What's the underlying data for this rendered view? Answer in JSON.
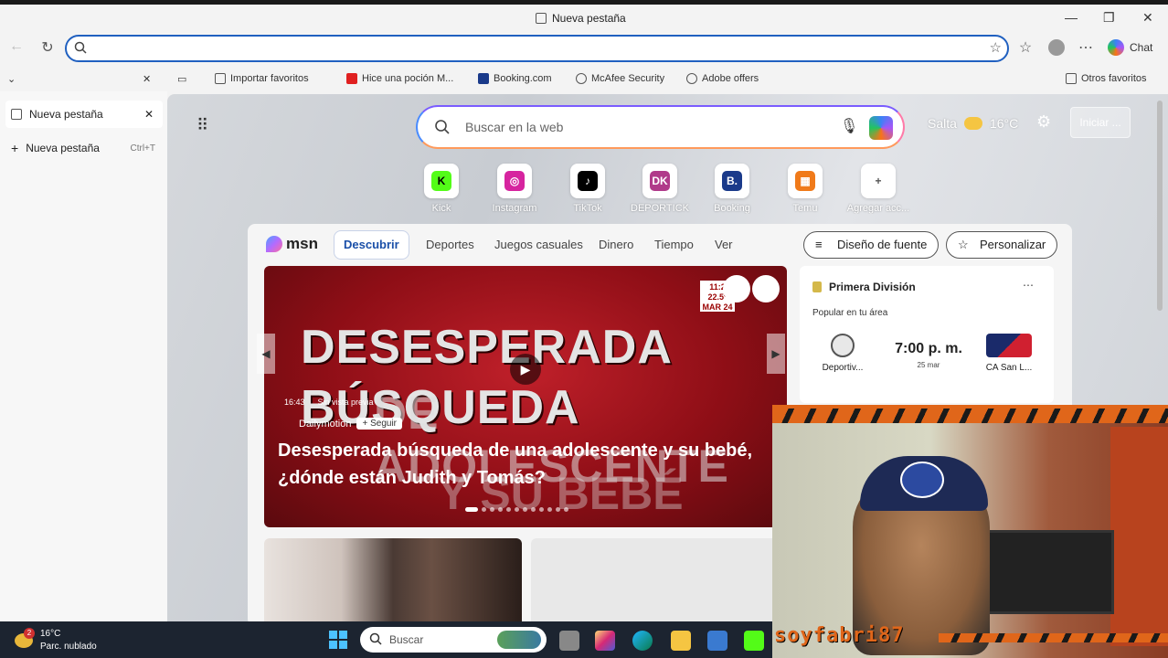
{
  "window": {
    "title": "Nueva pestaña"
  },
  "colors": {
    "accent": "#2060c0",
    "cam_accent": "#e0661a",
    "taskbar": "#1c2430"
  },
  "toolbar": {
    "chat_label": "Chat"
  },
  "favorites": [
    {
      "label": "Importar favoritos",
      "icon": "import-icon",
      "color": "#555555"
    },
    {
      "label": "Hice una poción M...",
      "icon": "youtube-icon",
      "color": "#e02020"
    },
    {
      "label": "Booking.com",
      "icon": "booking-icon",
      "color": "#1a3a8a"
    },
    {
      "label": "McAfee Security",
      "icon": "globe-icon",
      "color": "#555555"
    },
    {
      "label": "Adobe offers",
      "icon": "globe-icon",
      "color": "#555555"
    }
  ],
  "favorites_other": "Otros favoritos",
  "side_tabs": [
    {
      "label": "Nueva pestaña",
      "shortcut": ""
    },
    {
      "label": "Nueva pestaña",
      "shortcut": "Ctrl+T"
    }
  ],
  "search": {
    "placeholder": "Buscar en la web"
  },
  "weather": {
    "city": "Salta",
    "temp": "16°C"
  },
  "iniciar_label": "Iniciar ...",
  "quick_links": [
    {
      "label": "Kick",
      "glyph": "K",
      "color": "#53fc18",
      "fg": "#000000"
    },
    {
      "label": "Instagram",
      "glyph": "◎",
      "color": "#d6249f",
      "fg": "#ffffff"
    },
    {
      "label": "TikTok",
      "glyph": "♪",
      "color": "#000000",
      "fg": "#ffffff"
    },
    {
      "label": "DEPORTICK",
      "glyph": "DK",
      "color": "#b03a8a",
      "fg": "#ffffff"
    },
    {
      "label": "Booking",
      "glyph": "B.",
      "color": "#1a3a8a",
      "fg": "#ffffff"
    },
    {
      "label": "Temu",
      "glyph": "▦",
      "color": "#f07a1a",
      "fg": "#ffffff"
    },
    {
      "label": "Agregar acc...",
      "glyph": "+",
      "color": "#ffffff",
      "fg": "#555555"
    }
  ],
  "msn": {
    "logo": "msn",
    "tabs": [
      "Descubrir",
      "Deportes",
      "Juegos casuales",
      "Dinero",
      "Tiempo",
      "Ver"
    ],
    "source_design": "Diseño de fuente",
    "personalize": "Personalizar"
  },
  "hero": {
    "big_line1": "DESESPERADA BÚSQUEDA",
    "big_line2": "DE ADOLESCENTE",
    "big_line3": "Y SU BEBÉ",
    "duration": "16:43",
    "preview": "Sin vista previa",
    "source": "Dailymotion",
    "follow": "+ Seguir",
    "headline": "Desesperada búsqueda de una adolescente y su bebé, ¿dónde están Judith y Tomás?",
    "badge": "11:2 22.5° MAR 24"
  },
  "sports": {
    "league": "Primera División",
    "popular": "Popular en tu área",
    "time": "7:00 p. m.",
    "date": "25 mar",
    "home": "Deportiv...",
    "away": "CA San L..."
  },
  "cam": {
    "name": "soyfabri87"
  },
  "taskbar": {
    "temp": "16°C",
    "condition": "Parc. nublado",
    "badge": "2",
    "search": "Buscar"
  }
}
